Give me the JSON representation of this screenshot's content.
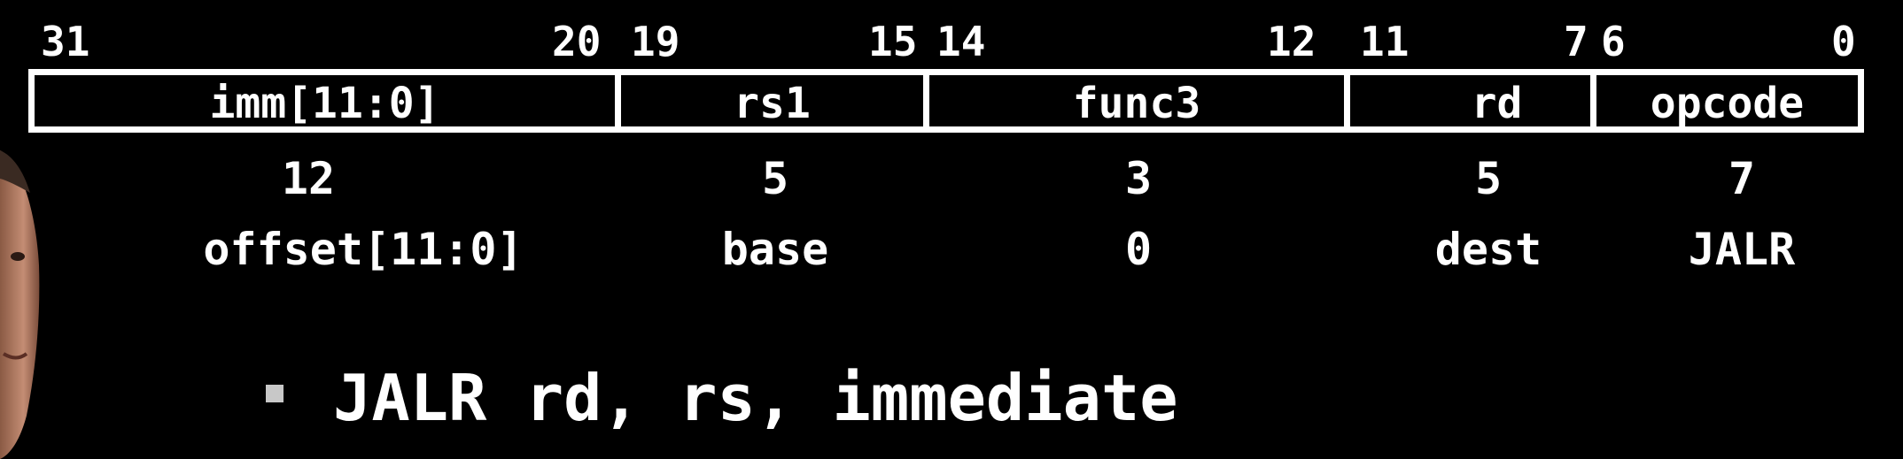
{
  "bit_positions": [
    "31",
    "20",
    "19",
    "15",
    "14",
    "12",
    "11",
    "7",
    "6",
    "0"
  ],
  "fields": [
    "imm[11:0]",
    "rs1",
    "func3",
    "rd",
    "opcode"
  ],
  "widths": [
    "12",
    "5",
    "3",
    "5",
    "7"
  ],
  "meanings": [
    "offset[11:0]",
    "base",
    "0",
    "dest",
    "JALR"
  ],
  "bullet": "JALR rd, rs, immediate"
}
